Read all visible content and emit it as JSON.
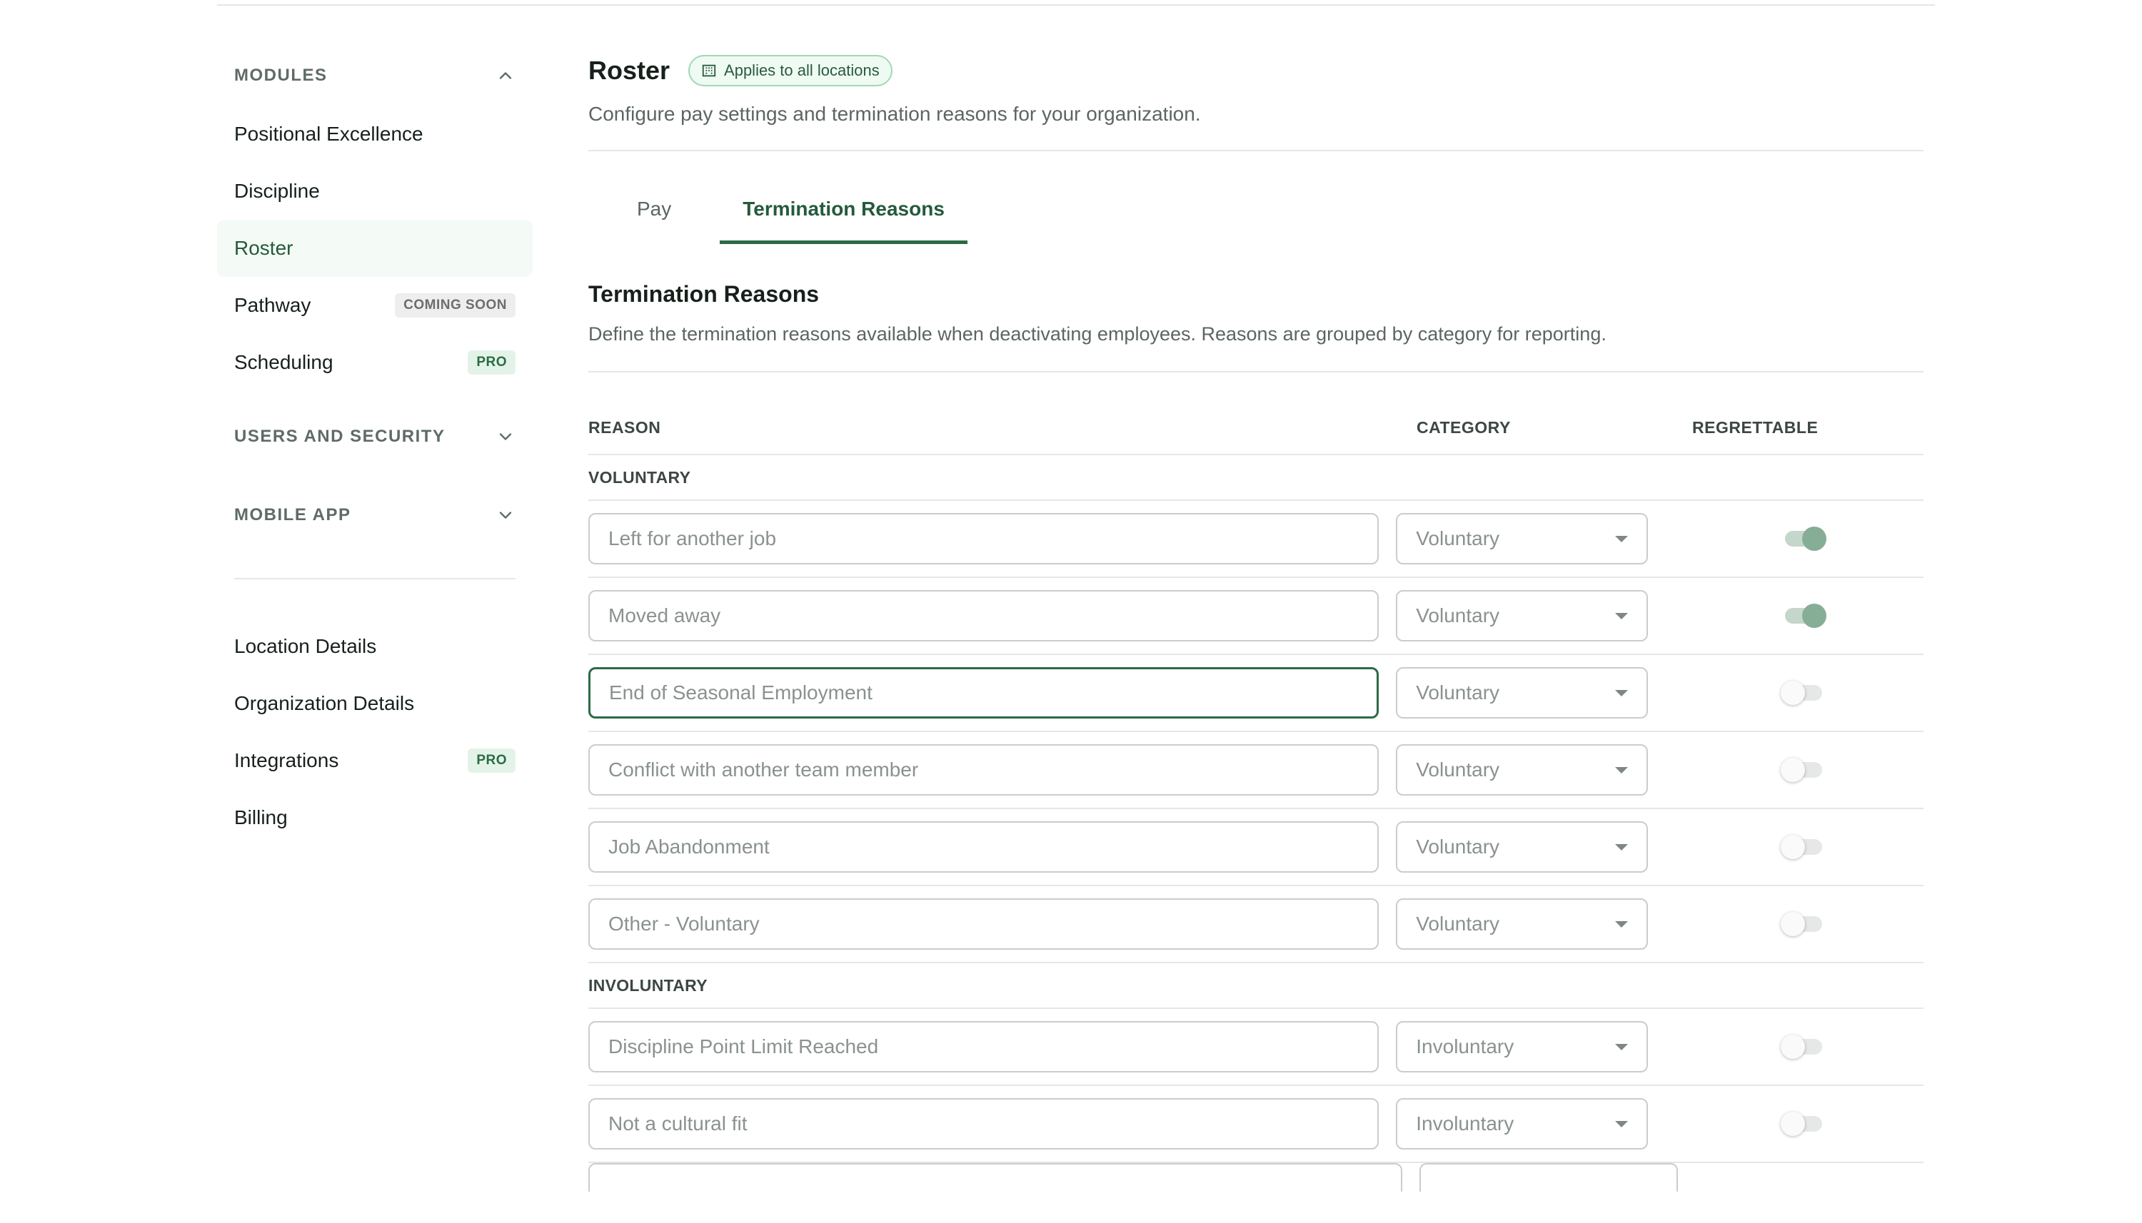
{
  "sidebar": {
    "modules_label": "MODULES",
    "modules_items": [
      {
        "label": "Positional Excellence",
        "badge": ""
      },
      {
        "label": "Discipline",
        "badge": ""
      },
      {
        "label": "Roster",
        "badge": ""
      },
      {
        "label": "Pathway",
        "badge": "COMING SOON"
      },
      {
        "label": "Scheduling",
        "badge": "PRO"
      }
    ],
    "users_security_label": "USERS AND SECURITY",
    "mobile_app_label": "MOBILE APP",
    "bottom_items": [
      {
        "label": "Location Details",
        "badge": ""
      },
      {
        "label": "Organization Details",
        "badge": ""
      },
      {
        "label": "Integrations",
        "badge": "PRO"
      },
      {
        "label": "Billing",
        "badge": ""
      }
    ],
    "active_item": "Roster"
  },
  "header": {
    "title": "Roster",
    "scope_chip": "Applies to all locations",
    "subtitle": "Configure pay settings and termination reasons for your organization."
  },
  "tabs": [
    {
      "label": "Pay",
      "active": false
    },
    {
      "label": "Termination Reasons",
      "active": true
    }
  ],
  "section": {
    "title": "Termination Reasons",
    "description": "Define the termination reasons available when deactivating employees. Reasons are grouped by category for reporting."
  },
  "table": {
    "columns": {
      "reason": "REASON",
      "category": "CATEGORY",
      "regrettable": "REGRETTABLE"
    },
    "groups": [
      {
        "label": "VOLUNTARY",
        "rows": [
          {
            "reason": "Left for another job",
            "category": "Voluntary",
            "regrettable": true
          },
          {
            "reason": "Moved away",
            "category": "Voluntary",
            "regrettable": true
          },
          {
            "reason": "End of Seasonal Employment",
            "category": "Voluntary",
            "regrettable": false
          },
          {
            "reason": "Conflict with another team member",
            "category": "Voluntary",
            "regrettable": false
          },
          {
            "reason": "Job Abandonment",
            "category": "Voluntary",
            "regrettable": false
          },
          {
            "reason": "Other - Voluntary",
            "category": "Voluntary",
            "regrettable": false
          }
        ]
      },
      {
        "label": "INVOLUNTARY",
        "rows": [
          {
            "reason": "Discipline Point Limit Reached",
            "category": "Involuntary",
            "regrettable": false
          },
          {
            "reason": "Not a cultural fit",
            "category": "Involuntary",
            "regrettable": false
          }
        ]
      }
    ]
  },
  "colors": {
    "accent": "#2d6a45",
    "active_bg": "#f4faf6",
    "chip_border": "#9fd9b4",
    "toggle_on": "#86ad95"
  },
  "icons": {
    "modules_toggle": "chevron-up-icon",
    "users_security_toggle": "chevron-down-icon",
    "mobile_app_toggle": "chevron-down-icon",
    "scope_chip": "building-icon",
    "select_caret": "caret-down-icon"
  }
}
